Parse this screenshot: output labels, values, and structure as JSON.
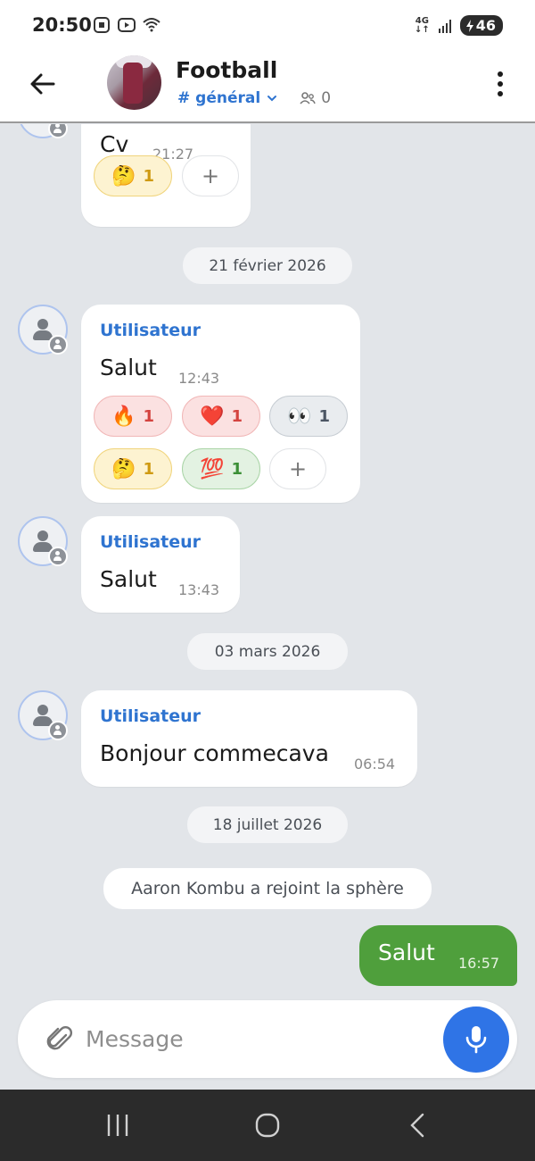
{
  "status_bar": {
    "time": "20:50",
    "network": "4G",
    "battery": "46",
    "icons": [
      "screenshot-icon",
      "media-icon",
      "wifi-icon",
      "signal-icon",
      "charging-icon"
    ]
  },
  "header": {
    "title": "Football",
    "channel": "# général",
    "member_count": "0"
  },
  "messages": [
    {
      "text": "Cv",
      "time": "21:27",
      "reactions": [
        {
          "emoji": "🤔",
          "count": "1"
        }
      ],
      "add": "+"
    },
    {
      "date": "21 février 2026"
    },
    {
      "sender": "Utilisateur",
      "text": "Salut",
      "time": "12:43",
      "reactions": [
        {
          "emoji": "🔥",
          "count": "1"
        },
        {
          "emoji": "❤️",
          "count": "1"
        },
        {
          "emoji": "👀",
          "count": "1"
        },
        {
          "emoji": "🤔",
          "count": "1"
        },
        {
          "emoji": "💯",
          "count": "1"
        }
      ],
      "add": "+"
    },
    {
      "sender": "Utilisateur",
      "text": "Salut",
      "time": "13:43"
    },
    {
      "date": "03 mars 2026"
    },
    {
      "sender": "Utilisateur",
      "text": "Bonjour commecava",
      "time": "06:54"
    },
    {
      "date": "18 juillet 2026"
    },
    {
      "system": "Aaron Kombu a rejoint la sphère"
    },
    {
      "outgoing": true,
      "text": "Salut",
      "time": "16:57"
    }
  ],
  "composer": {
    "placeholder": "Message"
  },
  "colors": {
    "accent": "#2f74d0",
    "outgoing_bubble": "#4f9f3c",
    "mic_button": "#2f74e6",
    "chat_background": "#e2e5e9"
  }
}
